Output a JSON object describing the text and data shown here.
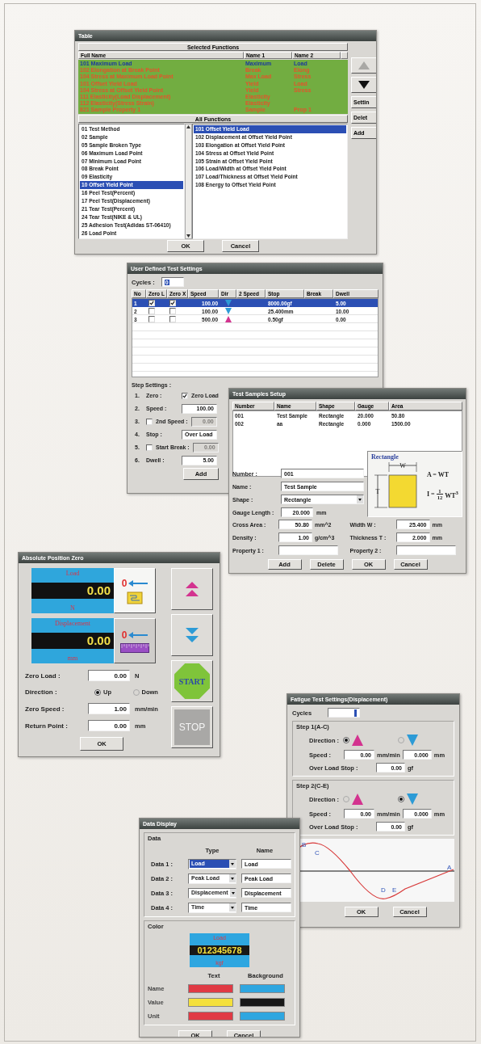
{
  "functions_window": {
    "title": "Table",
    "selected_header": "Selected Functions",
    "columns": [
      "Full Name",
      "Name 1",
      "Name 2"
    ],
    "rows": [
      {
        "cells": [
          "101 Maximum Load",
          "Maximum",
          "Load"
        ],
        "selected": true
      },
      {
        "cells": [
          "102 Elongation at Break Point",
          "Break",
          "Elong"
        ],
        "selected": false
      },
      {
        "cells": [
          "104 Stress at Maximum Load Point",
          "Max Load",
          "Stress"
        ],
        "selected": false
      },
      {
        "cells": [
          "101 Offset Yield Load",
          "Yield",
          "Load"
        ],
        "selected": false
      },
      {
        "cells": [
          "104 Stress at Offset Yield Point",
          "Yield",
          "Stress"
        ],
        "selected": false
      },
      {
        "cells": [
          "111 Elasticity(Load Displacement)",
          "Elasticity"
        ],
        "selected": false
      },
      {
        "cells": [
          "112 Elasticity(Stress Strain)",
          "Elasticity"
        ],
        "selected": false
      },
      {
        "cells": [
          "821 Sample Property 1",
          "Sample",
          "Prop 1"
        ],
        "selected": false
      }
    ],
    "all_header": "All Functions",
    "categories": [
      {
        "label": "01 Test Method",
        "selected": false
      },
      {
        "label": "02 Sample",
        "selected": false
      },
      {
        "label": "05 Sample Broken Type",
        "selected": false
      },
      {
        "label": "06 Maximum Load Point",
        "selected": false
      },
      {
        "label": "07 Minimum Load Point",
        "selected": false
      },
      {
        "label": "08 Break Point",
        "selected": false
      },
      {
        "label": "09 Elasticity",
        "selected": false
      },
      {
        "label": "10 Offset Yield Point",
        "selected": true
      },
      {
        "label": "16 Peel Test(Percent)",
        "selected": false
      },
      {
        "label": "17 Peel Test(Displacement)",
        "selected": false
      },
      {
        "label": "21 Tear Test(Percent)",
        "selected": false
      },
      {
        "label": "24 Tear Test(NIKE & UL)",
        "selected": false
      },
      {
        "label": "25 Adhesion Test(Adidas ST-06410)",
        "selected": false
      },
      {
        "label": "26 Load Point",
        "selected": false
      }
    ],
    "functions": [
      {
        "label": "101 Offset Yield Load",
        "selected": true
      },
      {
        "label": "102 Displacement at Offset Yield Point",
        "selected": false
      },
      {
        "label": "103 Elongation at Offset Yield Point",
        "selected": false
      },
      {
        "label": "104 Stress at Offset Yield Point",
        "selected": false
      },
      {
        "label": "105 Strain at Offset Yield Point",
        "selected": false
      },
      {
        "label": "106 Load/Width at Offset Yield Point",
        "selected": false
      },
      {
        "label": "107 Load/Thickness at Offset Yield Point",
        "selected": false
      },
      {
        "label": "108 Energy to Offset Yield Point",
        "selected": false
      }
    ],
    "side_buttons": [
      {
        "kind": "up",
        "disabled": true
      },
      {
        "kind": "down",
        "disabled": false
      },
      {
        "kind": "text",
        "label": "Settin"
      },
      {
        "kind": "text",
        "label": "Delet"
      },
      {
        "kind": "text",
        "label": "Add"
      }
    ],
    "buttons": [
      "OK",
      "Cancel"
    ]
  },
  "test_settings_window": {
    "title": "User Defined Test Settings",
    "cycles_label": "Cycles :",
    "cycles_value": "0",
    "columns": [
      "No",
      "Zero L",
      "Zero X",
      "Speed",
      "Dir",
      "2 Speed",
      "Stop",
      "Break",
      "Dwell"
    ],
    "rows": [
      {
        "kind": "down",
        "no": "1",
        "zero_l": true,
        "zero_x": true,
        "speed": "100.00",
        "stop": "8000.00gf",
        "dwell": "5.00",
        "selected": true
      },
      {
        "kind": "down",
        "no": "2",
        "zero_l": false,
        "zero_x": false,
        "speed": "100.00",
        "stop": "25.400mm",
        "dwell": "10.00",
        "selected": false
      },
      {
        "kind": "up",
        "no": "3",
        "zero_l": false,
        "zero_x": false,
        "speed": "500.00",
        "stop": "0.50gf",
        "dwell": "0.00",
        "selected": false
      }
    ],
    "step_title": "Step Settings :",
    "steps": [
      {
        "kind": "check",
        "number": "1.",
        "label": "Zero :",
        "check_label": "Zero Load",
        "checked": true
      },
      {
        "kind": "field",
        "number": "2.",
        "label": "Speed :",
        "value": "100.00"
      },
      {
        "kind": "check_field",
        "number": "3.",
        "check_label": "2nd Speed :",
        "checked": false,
        "value": "0.00",
        "disabled": true
      },
      {
        "kind": "field",
        "number": "4.",
        "label": "Stop :",
        "value": "Over Load"
      },
      {
        "kind": "check_field",
        "number": "5.",
        "check_label": "Start Break :",
        "checked": false,
        "value": "0.00",
        "disabled": true
      },
      {
        "kind": "field",
        "number": "6.",
        "label": "Dwell :",
        "value": "5.00"
      }
    ],
    "add_button": "Add"
  },
  "samples_window": {
    "title": "Test Samples Setup",
    "columns": [
      "Number",
      "Name",
      "Shape",
      "Gauge",
      "Area"
    ],
    "rows": [
      [
        "001",
        "Test Sample",
        "Rectangle",
        "20.000",
        "50.80"
      ],
      [
        "002",
        "aa",
        "Rectangle",
        "0.000",
        "1500.00"
      ]
    ],
    "fields": [
      {
        "kind": "text",
        "label": "Number :",
        "value": "001"
      },
      {
        "kind": "text",
        "label": "Name :",
        "value": "Test Sample"
      },
      {
        "kind": "select",
        "label": "Shape :",
        "value": "Rectangle"
      },
      {
        "kind": "number",
        "label": "Gauge Length :",
        "value": "20.000",
        "unit": "mm"
      }
    ],
    "paired_fields": [
      {
        "label": "Cross Area :",
        "value": "50.80",
        "unit": "mm^2"
      },
      {
        "label": "Width W :",
        "value": "25.400",
        "unit": "mm"
      },
      {
        "label": "Density :",
        "value": "1.00",
        "unit": "g/cm^3"
      },
      {
        "label": "Thickness T :",
        "value": "2.000",
        "unit": "mm"
      },
      {
        "label": "Property 1 :"
      },
      {
        "label": "Property 2 :"
      }
    ],
    "diagram": {
      "title": "Rectangle",
      "width_label": "W",
      "height_label": "T",
      "area_formula": "A = WT",
      "inertia_lhs": "I =",
      "fraction_numerator": "1",
      "fraction_denominator": "12",
      "inertia_rhs": "WT$^{3}$"
    },
    "buttons": [
      "Add",
      "Delete",
      "OK",
      "Cancel"
    ]
  },
  "zero_window": {
    "title": "Absolute Position Zero",
    "displays": [
      {
        "kind": "load",
        "name": "Load",
        "value": "0.00",
        "unit": "N",
        "zero_label": "0"
      },
      {
        "kind": "displacement",
        "name": "Displacement",
        "value": "0.00",
        "unit": "mm",
        "zero_label": "0"
      }
    ],
    "rows": [
      {
        "kind": "field",
        "label": "Zero Load :",
        "value": "0.00",
        "unit": "N"
      },
      {
        "kind": "radio",
        "label": "Direction :",
        "options": [
          {
            "label": "Up",
            "selected": true
          },
          {
            "label": "Down",
            "selected": false
          }
        ]
      },
      {
        "kind": "field",
        "label": "Zero Speed :",
        "value": "1.00",
        "unit": "mm/min"
      },
      {
        "kind": "field",
        "label": "Return Point :",
        "value": "0.00",
        "unit": "mm"
      }
    ],
    "ok_button": "OK",
    "jog_buttons": [
      {
        "kind": "up"
      },
      {
        "kind": "down"
      },
      {
        "kind": "start",
        "label": "START"
      },
      {
        "kind": "stop",
        "label": "STOP"
      }
    ]
  },
  "fatigue_window": {
    "title": "Fatigue Test Settings(Displacement)",
    "cycles_label": "Cycles",
    "steps": [
      {
        "title": "Step 1(A-C)",
        "direction_label": "Direction :",
        "options": [
          {
            "kind": "up",
            "selected": true
          },
          {
            "kind": "down",
            "selected": false
          }
        ],
        "speed_label": "Speed :",
        "speed": "0.00",
        "speed_unit": "mm/min",
        "distance": "0.000",
        "distance_unit": "mm",
        "overload_label": "Over Load Stop :",
        "overload": "0.00",
        "overload_unit": "gf"
      },
      {
        "title": "Step 2(C-E)",
        "direction_label": "Direction :",
        "options": [
          {
            "kind": "up",
            "selected": false
          },
          {
            "kind": "down",
            "selected": true
          }
        ],
        "speed_label": "Speed :",
        "speed": "0.00",
        "speed_unit": "mm/min",
        "distance": "0.000",
        "distance_unit": "mm",
        "overload_label": "Over Load Stop :",
        "overload": "0.00",
        "overload_unit": "gf"
      }
    ],
    "wave_labels": [
      "B",
      "C",
      "D",
      "E",
      "A"
    ],
    "buttons": [
      "OK",
      "Cancel"
    ]
  },
  "display_window": {
    "title": "Data Display",
    "data_group": "Data",
    "type_header": "Type",
    "name_header": "Name",
    "rows": [
      {
        "label": "Data 1 :",
        "type": "Load",
        "name": "Load",
        "selected": true
      },
      {
        "label": "Data 2 :",
        "type": "Peak Load",
        "name": "Peak Load",
        "selected": false
      },
      {
        "label": "Data 3 :",
        "type": "Displacement",
        "name": "Displacement",
        "selected": false
      },
      {
        "label": "Data 4 :",
        "type": "Time",
        "name": "Time",
        "selected": false
      }
    ],
    "color_group": "Color",
    "preview": {
      "name": "Load",
      "value": "012345678",
      "unit": "kgf"
    },
    "text_header": "Text",
    "background_header": "Background",
    "color_rows": [
      {
        "label": "Name",
        "text": {
          "color": "#e03a44"
        },
        "background": {
          "color": "#2ea6e0"
        }
      },
      {
        "label": "Value",
        "text": {
          "color": "#f4e03c"
        },
        "background": {
          "color": "#181818"
        }
      },
      {
        "label": "Unit",
        "text": {
          "color": "#e03a44"
        },
        "background": {
          "color": "#2ea6e0"
        }
      }
    ],
    "buttons": [
      "OK",
      "Cancel"
    ]
  }
}
